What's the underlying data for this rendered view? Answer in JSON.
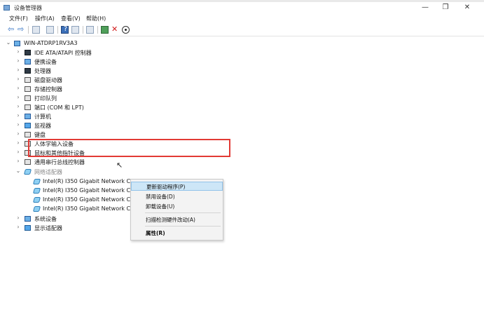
{
  "window": {
    "title": "设备管理器",
    "minimize_glyph": "—",
    "maximize_glyph": "❐",
    "close_glyph": "✕"
  },
  "menubar": {
    "file": "文件(F)",
    "action": "操作(A)",
    "view": "查看(V)",
    "help": "帮助(H)"
  },
  "toolbar": {
    "back_glyph": "⇦",
    "forward_glyph": "⇨",
    "help_glyph": "?",
    "delete_glyph": "✕"
  },
  "tree": {
    "chevron_collapsed": "›",
    "chevron_expanded": "⌄",
    "root": "WIN-ATDRP1RV3A3",
    "categories": [
      {
        "label": "IDE ATA/ATAPI 控制器",
        "icon": "ide-controller-icon"
      },
      {
        "label": "便携设备",
        "icon": "portable-device-icon"
      },
      {
        "label": "处理器",
        "icon": "processor-icon"
      },
      {
        "label": "磁盘驱动器",
        "icon": "disk-drive-icon"
      },
      {
        "label": "存储控制器",
        "icon": "storage-controller-icon"
      },
      {
        "label": "打印队列",
        "icon": "printer-icon"
      },
      {
        "label": "端口 (COM 和 LPT)",
        "icon": "port-icon"
      },
      {
        "label": "计算机",
        "icon": "computer-icon"
      },
      {
        "label": "监视器",
        "icon": "monitor-icon"
      },
      {
        "label": "键盘",
        "icon": "keyboard-icon"
      },
      {
        "label": "人体学输入设备",
        "icon": "hid-icon"
      },
      {
        "label": "鼠标和其他指针设备",
        "icon": "mouse-icon"
      },
      {
        "label": "通用串行总线控制器",
        "icon": "usb-icon"
      }
    ],
    "network_category": {
      "label": "网络适配器",
      "icon": "network-adapter-icon"
    },
    "network_adapters": [
      {
        "label": "Intel(R) I350 Gigabit Network Co..."
      },
      {
        "label": "Intel(R) I350 Gigabit Network Co"
      },
      {
        "label": "Intel(R) I350 Gigabit Network Co"
      },
      {
        "label": "Intel(R) I350 Gigabit Network Co"
      }
    ],
    "after_categories": [
      {
        "label": "系统设备",
        "icon": "system-device-icon"
      },
      {
        "label": "显示适配器",
        "icon": "display-adapter-icon"
      }
    ]
  },
  "context_menu": {
    "update_driver": "更新驱动程序(P)",
    "disable_device": "禁用设备(D)",
    "uninstall_device": "卸载设备(U)",
    "scan_hardware": "扫描检测硬件改动(A)",
    "properties": "属性(R)"
  },
  "colors": {
    "highlight_box": "#e23a35",
    "selected_menu_bg": "#cde6f7"
  }
}
